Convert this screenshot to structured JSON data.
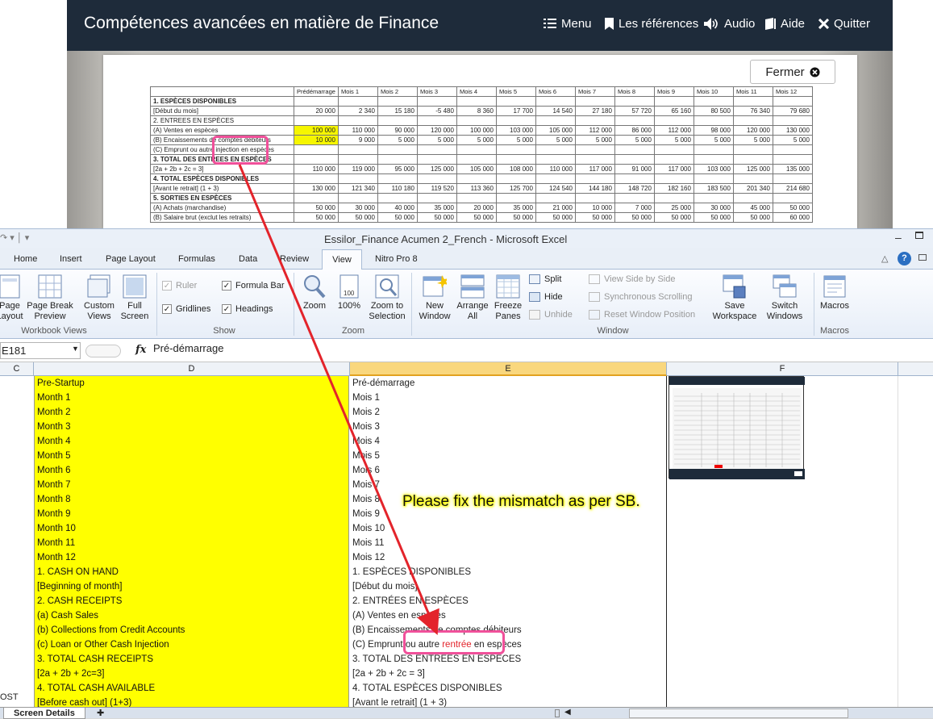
{
  "lms": {
    "title": "Compétences avancées en matière de Finance",
    "nav": [
      "Menu",
      "Les références",
      "Audio",
      "Aide",
      "Quitter"
    ],
    "close_label": "Fermer"
  },
  "fin_table": {
    "headers": [
      "Prédémarrage",
      "Mois 1",
      "Mois 2",
      "Mois 3",
      "Mois 4",
      "Mois 5",
      "Mois 6",
      "Mois 7",
      "Mois 8",
      "Mois 9",
      "Mois 10",
      "Mois 11",
      "Mois 12"
    ],
    "rows": [
      {
        "label": "1. ESPÈCES DISPONIBLES",
        "values": [
          "",
          "",
          "",
          "",
          "",
          "",
          "",
          "",
          "",
          "",
          "",
          "",
          ""
        ],
        "section": true
      },
      {
        "label": "[Début du mois]",
        "values": [
          "20 000",
          "2 340",
          "15 180",
          "-5 480",
          "8 360",
          "17 700",
          "14 540",
          "27 180",
          "57 720",
          "65 160",
          "80 500",
          "76 340",
          "79 680"
        ]
      },
      {
        "label": "2. ENTREES EN ESPÈCES",
        "values": [
          "",
          "",
          "",
          "",
          "",
          "",
          "",
          "",
          "",
          "",
          "",
          "",
          ""
        ]
      },
      {
        "label": "(A) Ventes en espèces",
        "values": [
          "100 000",
          "110 000",
          "90 000",
          "120 000",
          "100 000",
          "103 000",
          "105 000",
          "112 000",
          "86 000",
          "112 000",
          "98 000",
          "120 000",
          "130 000"
        ],
        "hl": true
      },
      {
        "label": "(B) Encaissements de comptes débiteurs",
        "values": [
          "10 000",
          "9 000",
          "5 000",
          "5 000",
          "5 000",
          "5 000",
          "5 000",
          "5 000",
          "5 000",
          "5 000",
          "5 000",
          "5 000",
          "5 000"
        ],
        "hl": true
      },
      {
        "label": "(C) Emprunt ou autre injection en espèces",
        "values": [
          "",
          "",
          "",
          "",
          "",
          "",
          "",
          "",
          "",
          "",
          "",
          "",
          ""
        ]
      },
      {
        "label": "3. TOTAL DES ENTREES EN ESPÈCES",
        "values": [
          "",
          "",
          "",
          "",
          "",
          "",
          "",
          "",
          "",
          "",
          "",
          "",
          ""
        ],
        "section": true
      },
      {
        "label": "[2a + 2b + 2c = 3]",
        "values": [
          "110 000",
          "119 000",
          "95 000",
          "125 000",
          "105 000",
          "108 000",
          "110 000",
          "117 000",
          "91 000",
          "117 000",
          "103 000",
          "125 000",
          "135 000"
        ]
      },
      {
        "label": "4. TOTAL ESPÈCES DISPONIBLES",
        "values": [
          "",
          "",
          "",
          "",
          "",
          "",
          "",
          "",
          "",
          "",
          "",
          "",
          ""
        ],
        "section": true
      },
      {
        "label": "[Avant le retrait] (1 + 3)",
        "values": [
          "130 000",
          "121 340",
          "110 180",
          "119 520",
          "113 360",
          "125 700",
          "124 540",
          "144 180",
          "148 720",
          "182 160",
          "183 500",
          "201 340",
          "214 680"
        ]
      },
      {
        "label": "5. SORTIES EN ESPÈCES",
        "values": [
          "",
          "",
          "",
          "",
          "",
          "",
          "",
          "",
          "",
          "",
          "",
          "",
          ""
        ],
        "section": true
      },
      {
        "label": "(A) Achats (marchandise)",
        "values": [
          "50 000",
          "30 000",
          "40 000",
          "35 000",
          "20 000",
          "35 000",
          "21 000",
          "10 000",
          "7 000",
          "25 000",
          "30 000",
          "45 000",
          "50 000"
        ]
      },
      {
        "label": "(B) Salaire brut (exclut les retraits)",
        "values": [
          "50 000",
          "50 000",
          "50 000",
          "50 000",
          "50 000",
          "50 000",
          "50 000",
          "50 000",
          "50 000",
          "50 000",
          "50 000",
          "50 000",
          "60 000"
        ]
      }
    ]
  },
  "excel": {
    "title": "Essilor_Finance Acumen 2_French  -  Microsoft Excel",
    "tabs": [
      "Home",
      "Insert",
      "Page Layout",
      "Formulas",
      "Data",
      "Review",
      "View",
      "Nitro Pro 8"
    ],
    "ribbon": {
      "page_layout": "Page Layout",
      "page_break": "Page Break Preview",
      "custom_views": "Custom Views",
      "full_screen": "Full Screen",
      "ruler": "Ruler",
      "formula_bar": "Formula Bar",
      "gridlines": "Gridlines",
      "headings": "Headings",
      "zoom": "Zoom",
      "zoom100": "100%",
      "zoom_sel": "Zoom to Selection",
      "new_window": "New Window",
      "arrange_all": "Arrange All",
      "freeze": "Freeze Panes",
      "split": "Split",
      "hide": "Hide",
      "unhide": "Unhide",
      "side_by_side": "View Side by Side",
      "sync_scroll": "Synchronous Scrolling",
      "reset_pos": "Reset Window Position",
      "save_ws": "Save Workspace",
      "switch_win": "Switch Windows",
      "macros": "Macros",
      "groups": [
        "Workbook Views",
        "Show",
        "Zoom",
        "Window",
        "Macros"
      ]
    },
    "namebox": "E181",
    "formula": "Pré-démarrage",
    "columns": [
      "C",
      "D",
      "E",
      "F"
    ],
    "colD": [
      "Pre-Startup",
      "Month 1",
      "Month 2",
      "Month 3",
      "Month 4",
      "Month 5",
      "Month 6",
      "Month 7",
      "Month 8",
      "Month 9",
      "Month 10",
      "Month 11",
      "Month 12",
      "1. CASH ON HAND",
      "[Beginning of month]",
      "2. CASH RECEIPTS",
      "(a) Cash Sales",
      "(b) Collections from Credit Accounts",
      "(c) Loan or Other Cash Injection",
      "3. TOTAL CASH RECEIPTS",
      "[2a + 2b + 2c=3]",
      "4. TOTAL CASH AVAILABLE",
      "[Before cash out] (1+3)"
    ],
    "colE": [
      "Pré-démarrage",
      "Mois 1",
      "Mois 2",
      "Mois 3",
      "Mois 4",
      "Mois 5",
      "Mois 6",
      "Mois 7",
      "Mois 8",
      "Mois 9",
      "Mois 10",
      "Mois 11",
      "Mois 12",
      "1. ESPÈCES DISPONIBLES",
      "[Début du mois]",
      "2. ENTRÉES EN ESPÈCES",
      "(A) Ventes en espèces",
      "(B) Encaissements de comptes débiteurs",
      "",
      "3. TOTAL DES ENTREES EN ESPECES",
      "[2a + 2b + 2c = 3]",
      "4. TOTAL ESPÈCES DISPONIBLES",
      "[Avant le retrait] (1 + 3)"
    ],
    "colE_row19": {
      "before": "(C) Emprunt ou autre ",
      "red": "rentrée",
      "after": " en espèces"
    },
    "colC_last": "OST",
    "sheet_tab": "Screen Details"
  },
  "annotation": "Please fix the mismatch as per SB.",
  "colors": {
    "lms_bar": "#1e2b3a",
    "highlight": "#ffff00",
    "annotation_pink": "#f0509a",
    "arrow": "#e3242b",
    "red_text": "#e3242b"
  }
}
